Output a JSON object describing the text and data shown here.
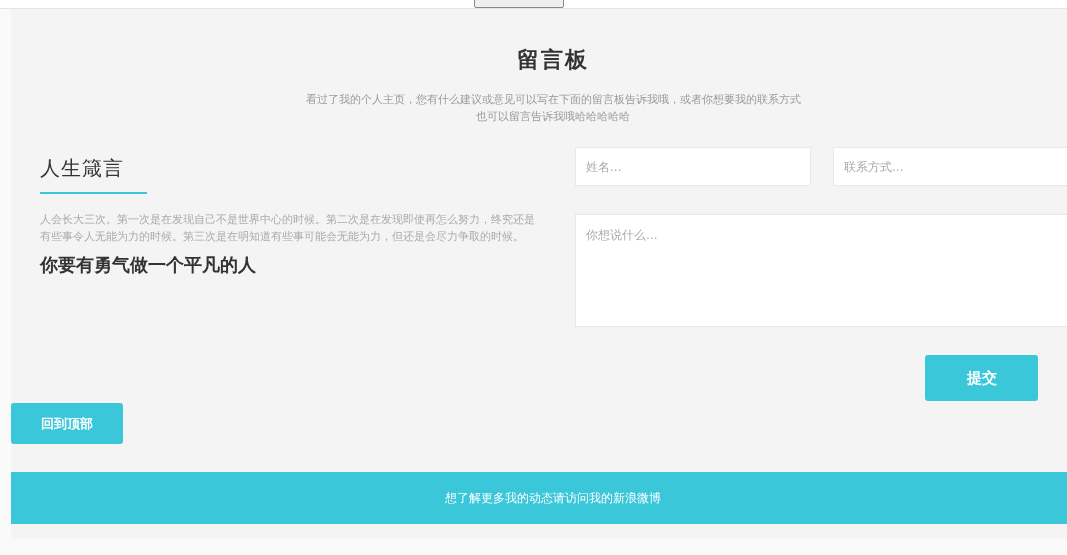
{
  "title": "留言板",
  "intro": "看过了我的个人主页，您有什么建议或意见可以写在下面的留言板告诉我哦，或者你想要我的联系方式也可以留言告诉我哦哈哈哈哈哈",
  "motto": {
    "heading": "人生箴言",
    "text": "人会长大三次。第一次是在发现自己不是世界中心的时候。第二次是在发现即使再怎么努力，终究还是有些事令人无能为力的时候。第三次是在明知道有些事可能会无能为力，但还是会尽力争取的时候。",
    "slogan": "你要有勇气做一个平凡的人"
  },
  "form": {
    "name": {
      "placeholder": "姓名..."
    },
    "contact": {
      "placeholder": "联系方式..."
    },
    "message": {
      "placeholder": "你想说什么..."
    },
    "submit": "提交"
  },
  "back_to_top": "回到顶部",
  "footer": "想了解更多我的动态请访问我的新浪微博"
}
